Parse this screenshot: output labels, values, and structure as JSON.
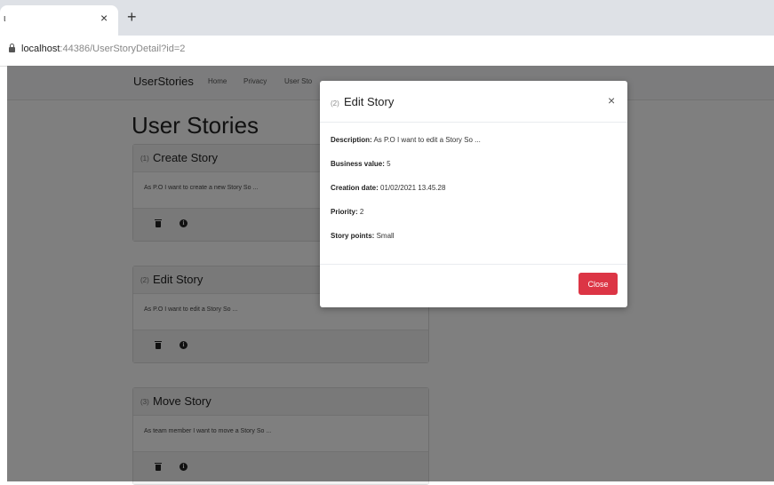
{
  "browser": {
    "tab_title": "ι",
    "tab_close": "×",
    "new_tab": "+",
    "url_host": "localhost",
    "url_rest": ":44386/UserStoryDetail?id=2"
  },
  "navbar": {
    "brand": "UserStories",
    "links": [
      "Home",
      "Privacy",
      "User Sto"
    ]
  },
  "page": {
    "heading": "User Stories",
    "cards": [
      {
        "num": "(1)",
        "title": "Create Story",
        "description": "As P.O I want to create a new Story So ..."
      },
      {
        "num": "(2)",
        "title": "Edit Story",
        "description": "As P.O I want to edit a Story So ..."
      },
      {
        "num": "(3)",
        "title": "Move Story",
        "description": "As team member I want to move a Story So ..."
      }
    ],
    "icons": [
      "trash-icon",
      "info-icon"
    ]
  },
  "modal": {
    "num": "(2)",
    "title": "Edit Story",
    "close_symbol": "×",
    "fields": [
      {
        "label": "Description:",
        "value": "As P.O I want to edit a Story So ..."
      },
      {
        "label": "Business value:",
        "value": "5"
      },
      {
        "label": "Creation date:",
        "value": "01/02/2021 13.45.28"
      },
      {
        "label": "Priority:",
        "value": "2"
      },
      {
        "label": "Story points:",
        "value": "Small"
      }
    ],
    "close_button": "Close",
    "close_button_color": "#dc3545"
  }
}
